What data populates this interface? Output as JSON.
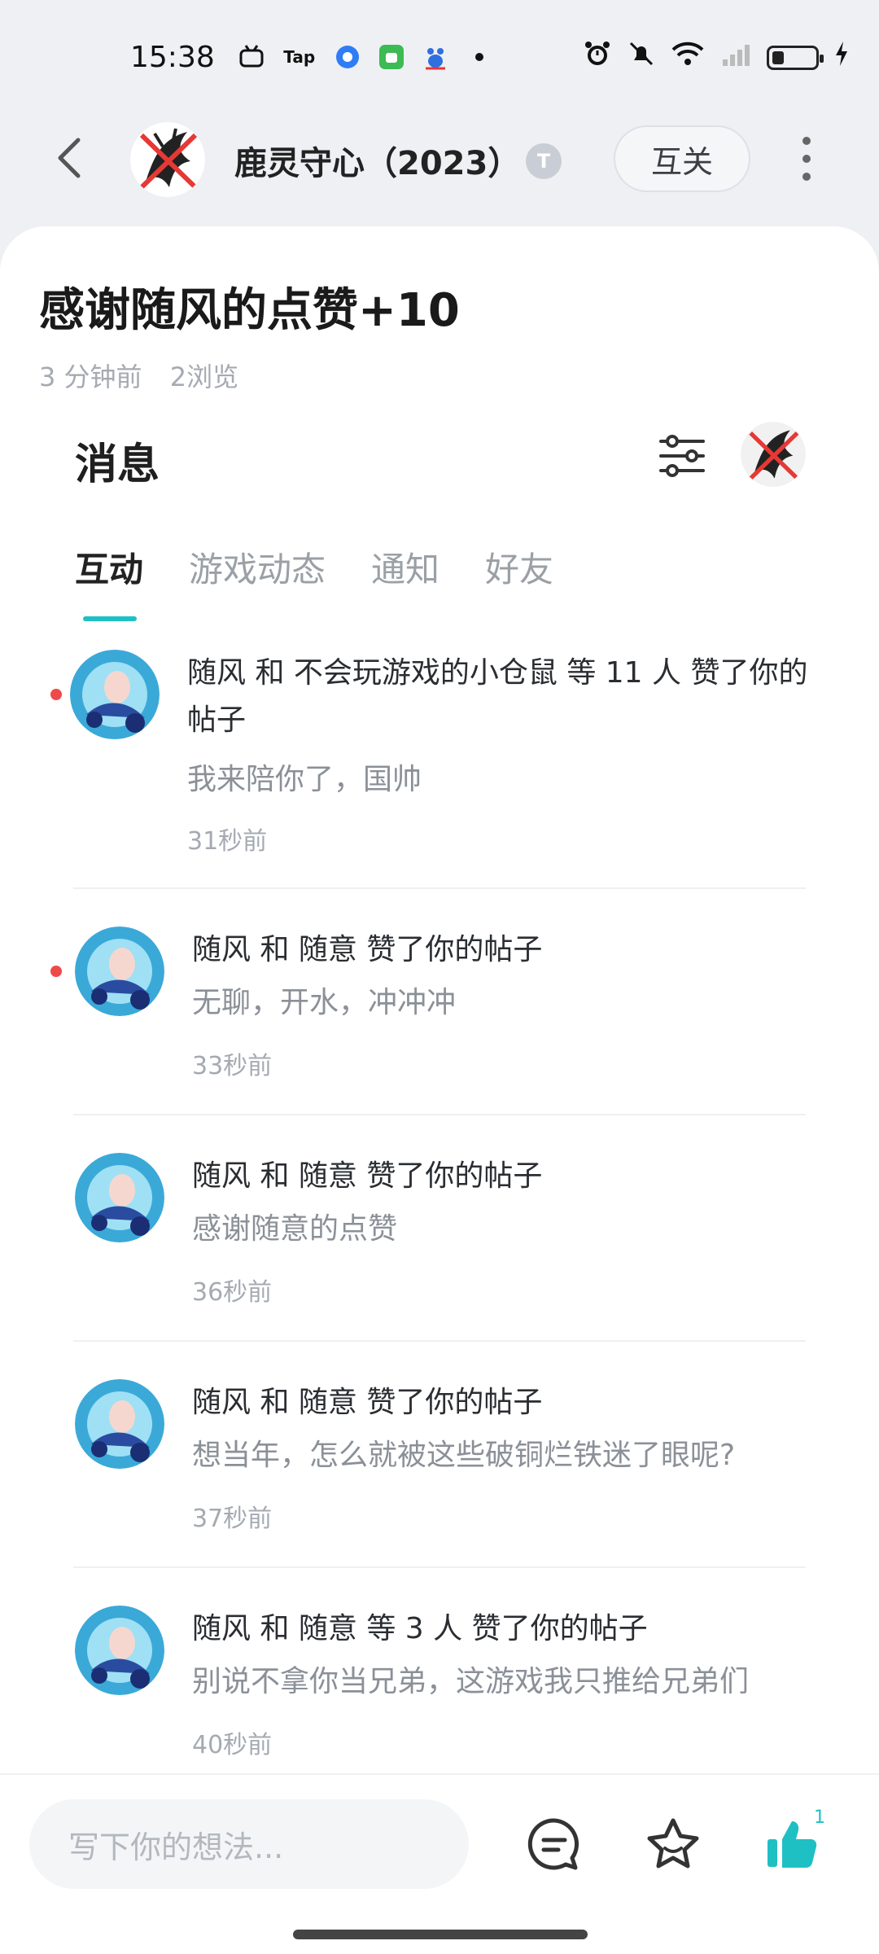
{
  "status_bar": {
    "time": "15:38",
    "app_icons": [
      "bilibili-tv-icon",
      "taptap-icon",
      "browser-icon",
      "android-store-icon",
      "baidu-icon"
    ],
    "tap_label": "Tap",
    "system_icons": [
      "alarm-icon",
      "mute-icon",
      "wifi-icon",
      "signal-icon",
      "battery-icon",
      "charging-icon"
    ]
  },
  "header": {
    "user_name": "鹿灵守心（2023）",
    "badge_text": "T",
    "follow_label": "互关"
  },
  "post": {
    "title": "感谢随风的点赞+10",
    "time_ago": "3 分钟前",
    "views": "2浏览"
  },
  "messages": {
    "title": "消息",
    "tabs": [
      {
        "label": "互动",
        "active": true
      },
      {
        "label": "游戏动态",
        "active": false
      },
      {
        "label": "通知",
        "active": false
      },
      {
        "label": "好友",
        "active": false
      }
    ],
    "items": [
      {
        "unread": true,
        "text": "随风 和 不会玩游戏的小仓鼠 等 11 人 赞了你的帖子",
        "post": "我来陪你了，国帅",
        "time": "31秒前"
      },
      {
        "unread": true,
        "text": "随风 和 随意 赞了你的帖子",
        "post": "无聊，开水，冲冲冲",
        "time": "33秒前"
      },
      {
        "unread": false,
        "text": "随风 和 随意 赞了你的帖子",
        "post": "感谢随意的点赞",
        "time": "36秒前"
      },
      {
        "unread": false,
        "text": "随风 和 随意 赞了你的帖子",
        "post": "想当年，怎么就被这些破铜烂铁迷了眼呢?",
        "time": "37秒前"
      },
      {
        "unread": false,
        "text": "随风 和 随意 等 3 人 赞了你的帖子",
        "post": "别说不拿你当兄弟，这游戏我只推给兄弟们",
        "time": "40秒前"
      }
    ]
  },
  "bottom": {
    "placeholder": "写下你的想法...",
    "like_count": "1",
    "accent": "#1fc0c3"
  }
}
